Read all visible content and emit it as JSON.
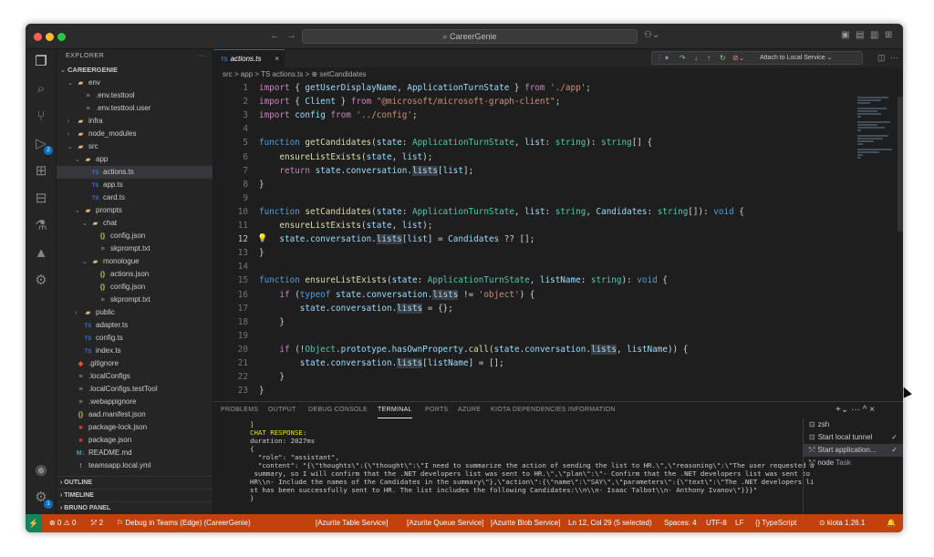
{
  "titlebar": {
    "title": "CareerGenie",
    "back": "←",
    "forward": "→"
  },
  "activity": {
    "icons": [
      "explorer-icon",
      "search-icon",
      "source-control-icon",
      "run-debug-icon",
      "extensions-icon",
      "remote-explorer-icon",
      "testing-icon",
      "azure-icon",
      "teams-toolkit-icon",
      "account-icon",
      "settings-icon"
    ],
    "run_badge": "2",
    "settings_badge": "1"
  },
  "explorer": {
    "header": "EXPLORER",
    "more": "···",
    "root": "CAREERGENIE",
    "items": [
      {
        "label": "env",
        "kind": "folder",
        "depth": 1,
        "chev": "⌄"
      },
      {
        "label": ".env.testtool",
        "kind": "txt",
        "depth": 2,
        "chev": ""
      },
      {
        "label": ".env.testtool.user",
        "kind": "txt",
        "depth": 2,
        "chev": ""
      },
      {
        "label": "infra",
        "kind": "folder",
        "depth": 1,
        "chev": "›"
      },
      {
        "label": "node_modules",
        "kind": "folder",
        "depth": 1,
        "chev": "›"
      },
      {
        "label": "src",
        "kind": "folder",
        "depth": 1,
        "chev": "⌄"
      },
      {
        "label": "app",
        "kind": "folder",
        "depth": 2,
        "chev": "⌄"
      },
      {
        "label": "actions.ts",
        "kind": "ts",
        "depth": 3,
        "chev": "",
        "selected": true
      },
      {
        "label": "app.ts",
        "kind": "ts",
        "depth": 3,
        "chev": ""
      },
      {
        "label": "card.ts",
        "kind": "ts",
        "depth": 3,
        "chev": ""
      },
      {
        "label": "prompts",
        "kind": "folder",
        "depth": 2,
        "chev": "⌄"
      },
      {
        "label": "chat",
        "kind": "folder",
        "depth": 3,
        "chev": "⌄"
      },
      {
        "label": "config.json",
        "kind": "json",
        "depth": 4,
        "chev": ""
      },
      {
        "label": "skprompt.txt",
        "kind": "txt",
        "depth": 4,
        "chev": ""
      },
      {
        "label": "monologue",
        "kind": "folder",
        "depth": 3,
        "chev": "⌄"
      },
      {
        "label": "actions.json",
        "kind": "json",
        "depth": 4,
        "chev": ""
      },
      {
        "label": "config.json",
        "kind": "json",
        "depth": 4,
        "chev": ""
      },
      {
        "label": "skprompt.txt",
        "kind": "txt",
        "depth": 4,
        "chev": ""
      },
      {
        "label": "public",
        "kind": "folder",
        "depth": 2,
        "chev": "›"
      },
      {
        "label": "adapter.ts",
        "kind": "ts",
        "depth": 2,
        "chev": ""
      },
      {
        "label": "config.ts",
        "kind": "ts",
        "depth": 2,
        "chev": ""
      },
      {
        "label": "index.ts",
        "kind": "ts",
        "depth": 2,
        "chev": ""
      },
      {
        "label": ".gitignore",
        "kind": "git",
        "depth": 1,
        "chev": ""
      },
      {
        "label": ".localConfigs",
        "kind": "txt",
        "depth": 1,
        "chev": ""
      },
      {
        "label": ".localConfigs.testTool",
        "kind": "txt",
        "depth": 1,
        "chev": ""
      },
      {
        "label": ".webappignore",
        "kind": "txt",
        "depth": 1,
        "chev": ""
      },
      {
        "label": "aad.manifest.json",
        "kind": "json",
        "depth": 1,
        "chev": ""
      },
      {
        "label": "package-lock.json",
        "kind": "npm",
        "depth": 1,
        "chev": ""
      },
      {
        "label": "package.json",
        "kind": "npm",
        "depth": 1,
        "chev": ""
      },
      {
        "label": "README.md",
        "kind": "md",
        "depth": 1,
        "chev": ""
      },
      {
        "label": "teamsapp.local.yml",
        "kind": "yml",
        "depth": 1,
        "chev": ""
      }
    ],
    "sections": [
      "OUTLINE",
      "TIMELINE",
      "BRUNO PANEL"
    ]
  },
  "editor": {
    "tab_label": "actions.ts",
    "tab_badge": "TS",
    "tab_close": "×",
    "breadcrumb": "src > app > TS actions.ts > ⊕ setCandidates",
    "attach_label": "Attach to Local Service",
    "lines": [
      {
        "n": "1",
        "html": "<span class=\"kw2\">import</span> { <span class=\"var\">getUserDisplayName</span>, <span class=\"var\">ApplicationTurnState</span> } <span class=\"kw2\">from</span> <span class=\"str\">'./app'</span>;"
      },
      {
        "n": "2",
        "html": "<span class=\"kw2\">import</span> { <span class=\"var\">Client</span> } <span class=\"kw2\">from</span> <span class=\"str\">\"@microsoft/microsoft-graph-client\"</span>;"
      },
      {
        "n": "3",
        "html": "<span class=\"kw2\">import</span> <span class=\"var\">config</span> <span class=\"kw2\">from</span> <span class=\"str\">'../config'</span>;"
      },
      {
        "n": "4",
        "html": ""
      },
      {
        "n": "5",
        "html": "<span class=\"kw\">function</span> <span class=\"fn\">getCandidates</span>(<span class=\"var\">state</span>: <span class=\"ty\">ApplicationTurnState</span>, <span class=\"var\">list</span>: <span class=\"ty\">string</span>): <span class=\"ty\">string</span>[] {"
      },
      {
        "n": "6",
        "html": "    <span class=\"fn\">ensureListExists</span>(<span class=\"var\">state</span>, <span class=\"var\">list</span>);"
      },
      {
        "n": "7",
        "html": "    <span class=\"kw2\">return</span> <span class=\"var\">state</span>.<span class=\"var\">conversation</span>.<span class=\"hl\">lists</span>[<span class=\"var\">list</span>];"
      },
      {
        "n": "8",
        "html": "}"
      },
      {
        "n": "9",
        "html": ""
      },
      {
        "n": "10",
        "html": "<span class=\"kw\">function</span> <span class=\"fn\">setCandidates</span>(<span class=\"var\">state</span>: <span class=\"ty\">ApplicationTurnState</span>, <span class=\"var\">list</span>: <span class=\"ty\">string</span>, <span class=\"var\">Candidates</span>: <span class=\"ty\">string</span>[]): <span class=\"kw\">void</span> {"
      },
      {
        "n": "11",
        "html": "    <span class=\"fn\">ensureListExists</span>(<span class=\"var\">state</span>, <span class=\"var\">list</span>);"
      },
      {
        "n": "12",
        "html": "    <span class=\"var\">state</span>.<span class=\"var\">conversation</span>.<span class=\"hl\">lists</span>[<span class=\"var\">list</span>] = <span class=\"var\">Candidates</span> ?? [];",
        "current": true
      },
      {
        "n": "13",
        "html": "}"
      },
      {
        "n": "14",
        "html": ""
      },
      {
        "n": "15",
        "html": "<span class=\"kw\">function</span> <span class=\"fn\">ensureListExists</span>(<span class=\"var\">state</span>: <span class=\"ty\">ApplicationTurnState</span>, <span class=\"var\">listName</span>: <span class=\"ty\">string</span>): <span class=\"kw\">void</span> {"
      },
      {
        "n": "16",
        "html": "    <span class=\"kw2\">if</span> (<span class=\"kw\">typeof</span> <span class=\"var\">state</span>.<span class=\"var\">conversation</span>.<span class=\"hl\">lists</span> != <span class=\"str\">'object'</span>) {"
      },
      {
        "n": "17",
        "html": "        <span class=\"var\">state</span>.<span class=\"var\">conversation</span>.<span class=\"hl\">lists</span> = {};"
      },
      {
        "n": "18",
        "html": "    }"
      },
      {
        "n": "19",
        "html": ""
      },
      {
        "n": "20",
        "html": "    <span class=\"kw2\">if</span> (!<span class=\"ty\">Object</span>.<span class=\"var\">prototype</span>.<span class=\"var\">hasOwnProperty</span>.<span class=\"fn\">call</span>(<span class=\"var\">state</span>.<span class=\"var\">conversation</span>.<span class=\"hl\">lists</span>, <span class=\"var\">listName</span>)) {"
      },
      {
        "n": "21",
        "html": "        <span class=\"var\">state</span>.<span class=\"var\">conversation</span>.<span class=\"hl\">lists</span>[<span class=\"var\">listName</span>] = [];"
      },
      {
        "n": "22",
        "html": "    }"
      },
      {
        "n": "23",
        "html": "}"
      }
    ]
  },
  "panel": {
    "tabs": [
      "PROBLEMS",
      "OUTPUT",
      "DEBUG CONSOLE",
      "TERMINAL",
      "PORTS",
      "AZURE",
      "KIOTA DEPENDENCIES INFORMATION"
    ],
    "active_tab": "TERMINAL",
    "actions": "+⌄  ···  ^  ×",
    "terminal_lines": [
      {
        "text": "]",
        "cls": ""
      },
      {
        "text": "CHAT RESPONSE:",
        "cls": "t-yellow"
      },
      {
        "text": "duration: 2027ms",
        "cls": ""
      },
      {
        "text": "{",
        "cls": ""
      },
      {
        "text": "  \"role\": \"assistant\",",
        "cls": ""
      },
      {
        "text": "  \"content\": \"{\\\"thoughts\\\":{\\\"thought\\\":\\\"I need to summarize the action of sending the list to HR.\\\",\\\"reasoning\\\":\\\"The user requested a",
        "cls": ""
      },
      {
        "text": " summary, so I will confirm that the .NET developers list was sent to HR.\\\",\\\"plan\\\":\\\"- Confirm that the .NET developers list was sent to",
        "cls": ""
      },
      {
        "text": "HR\\\\n- Include the names of the Candidates in the summary\\\"},\\\"action\\\":{\\\"name\\\":\\\"SAY\\\",\\\"parameters\\\":{\\\"text\\\":\\\"The .NET developers li",
        "cls": ""
      },
      {
        "text": "st has been successfully sent to HR. The list includes the following Candidates:\\\\n\\\\n- Isaac Talbot\\\\n- Anthony Ivanov\\\"}}}\"",
        "cls": ""
      },
      {
        "text": "}",
        "cls": ""
      }
    ],
    "terminals": [
      {
        "label": "zsh",
        "icon": "⊡",
        "check": "",
        "sub": ""
      },
      {
        "label": "Start local tunnel",
        "icon": "⊡",
        "check": "✓",
        "sub": ""
      },
      {
        "label": "Start application...",
        "icon": "⤲",
        "check": "✓",
        "sub": "",
        "selected": true
      },
      {
        "label": "node",
        "icon": "⤲",
        "check": "",
        "sub": "Task"
      }
    ]
  },
  "status": {
    "remote": "⚡",
    "problems": "⊗ 0 ⚠ 0",
    "ports": "⤱ 2",
    "debug": "⚐ Debug in Teams (Edge) (CareerGenie)",
    "azurite_table": "[Azurite Table Service]",
    "azurite_queue": "[Azurite Queue Service]",
    "azurite_blob": "[Azurite Blob Service]",
    "cursor": "Ln 12, Col 29 (5 selected)",
    "spaces": "Spaces: 4",
    "encoding": "UTF-8",
    "eol": "LF",
    "language": "{} TypeScript",
    "kiota": "⊙ kiota 1.26.1",
    "bell": "🔔"
  }
}
